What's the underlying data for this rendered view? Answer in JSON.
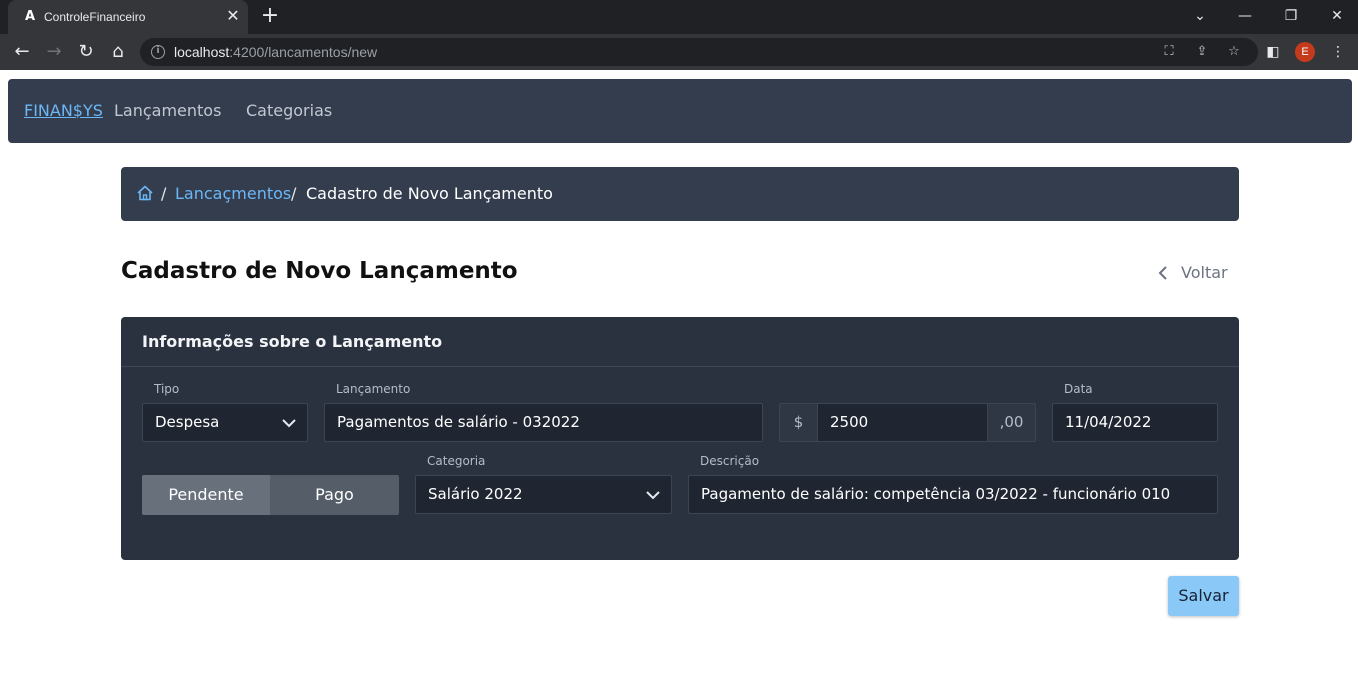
{
  "browser": {
    "tab_title": "ControleFinanceiro",
    "tab_logo": "A",
    "url_host": "localhost",
    "url_path": ":4200/lancamentos/new",
    "profile_initial": "E"
  },
  "navbar": {
    "brand": "FINAN$YS",
    "links": [
      "Lançamentos",
      "Categorias"
    ]
  },
  "breadcrumb": {
    "separator": "/",
    "link": "Lancaçmentos",
    "current": "Cadastro de Novo Lançamento"
  },
  "page": {
    "title": "Cadastro de Novo Lançamento",
    "back_label": "Voltar"
  },
  "form": {
    "card_title": "Informações sobre o Lançamento",
    "tipo": {
      "label": "Tipo",
      "value": "Despesa"
    },
    "lancamento": {
      "label": "Lançamento",
      "value": "Pagamentos de salário - 032022"
    },
    "valor": {
      "prefix": "$",
      "value": "2500",
      "suffix": ",00"
    },
    "data": {
      "label": "Data",
      "value": "11/04/2022"
    },
    "status": {
      "options": [
        "Pendente",
        "Pago"
      ],
      "selected": "Pendente"
    },
    "categoria": {
      "label": "Categoria",
      "value": "Salário 2022"
    },
    "descricao": {
      "label": "Descrição",
      "value": "Pagamento de salário: competência 03/2022 - funcionário 010"
    },
    "save_label": "Salvar"
  },
  "colors": {
    "nav_bg": "#343d4e",
    "card_bg": "#2b323f",
    "link": "#6cb7f5",
    "save_button": "#8ac8f8"
  }
}
